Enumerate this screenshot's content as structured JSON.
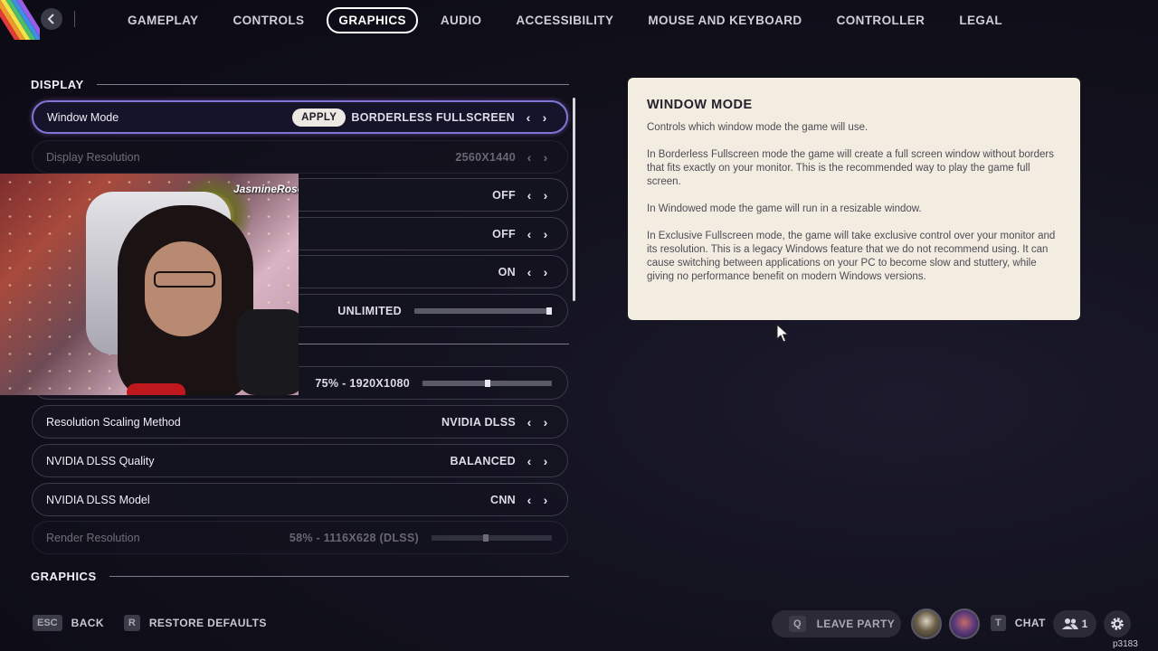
{
  "nav": {
    "tabs": [
      "GAMEPLAY",
      "CONTROLS",
      "GRAPHICS",
      "AUDIO",
      "ACCESSIBILITY",
      "MOUSE AND KEYBOARD",
      "CONTROLLER",
      "LEGAL"
    ],
    "active_tab": "GRAPHICS",
    "back_icon": "chevron-left-icon"
  },
  "sections": {
    "display": "DISPLAY",
    "graphics": "GRAPHICS"
  },
  "settings": {
    "window_mode": {
      "label": "Window Mode",
      "value": "BORDERLESS FULLSCREEN",
      "apply": "APPLY"
    },
    "display_resolution": {
      "label": "Display Resolution",
      "value": "2560X1440"
    },
    "row3": {
      "value": "OFF"
    },
    "row4": {
      "value": "OFF"
    },
    "row5": {
      "value": "ON"
    },
    "row6": {
      "value": "UNLIMITED",
      "slider_fraction": 1.0
    },
    "row7": {
      "value": "75% - 1920X1080",
      "slider_fraction": 0.5
    },
    "resolution_scaling_method": {
      "label": "Resolution Scaling Method",
      "value": "NVIDIA DLSS"
    },
    "dlss_quality": {
      "label": "NVIDIA DLSS Quality",
      "value": "BALANCED"
    },
    "dlss_model": {
      "label": "NVIDIA DLSS Model",
      "value": "CNN"
    },
    "render_resolution": {
      "label": "Render Resolution",
      "value": "58% - 1116X628 (DLSS)",
      "slider_fraction": 0.45
    }
  },
  "info": {
    "title": "WINDOW MODE",
    "paragraphs": [
      "Controls which window mode the game will use.",
      "In Borderless Fullscreen mode the game will create a full screen window without borders that fits exactly on your monitor. This is the recommended way to play the game full screen.",
      "In Windowed mode the game will run in a resizable window.",
      "In Exclusive Fullscreen mode, the game will take exclusive control over your monitor and its resolution. This is a legacy Windows feature that we do not recommend using. It can cause switching between applications on your PC to become slow and stuttery, while giving no performance benefit on modern Windows versions."
    ]
  },
  "webcam": {
    "tag": "JasmineRosexo"
  },
  "footer": {
    "back_key": "ESC",
    "back_label": "BACK",
    "restore_key": "R",
    "restore_label": "RESTORE DEFAULTS",
    "leave_key": "Q",
    "leave_label": "LEAVE PARTY",
    "chat_key": "T",
    "chat_label": "CHAT",
    "friends_count": "1",
    "build": "p3183"
  },
  "colors": {
    "accent": "#7e76d6",
    "info_bg": "#f3ede1"
  }
}
